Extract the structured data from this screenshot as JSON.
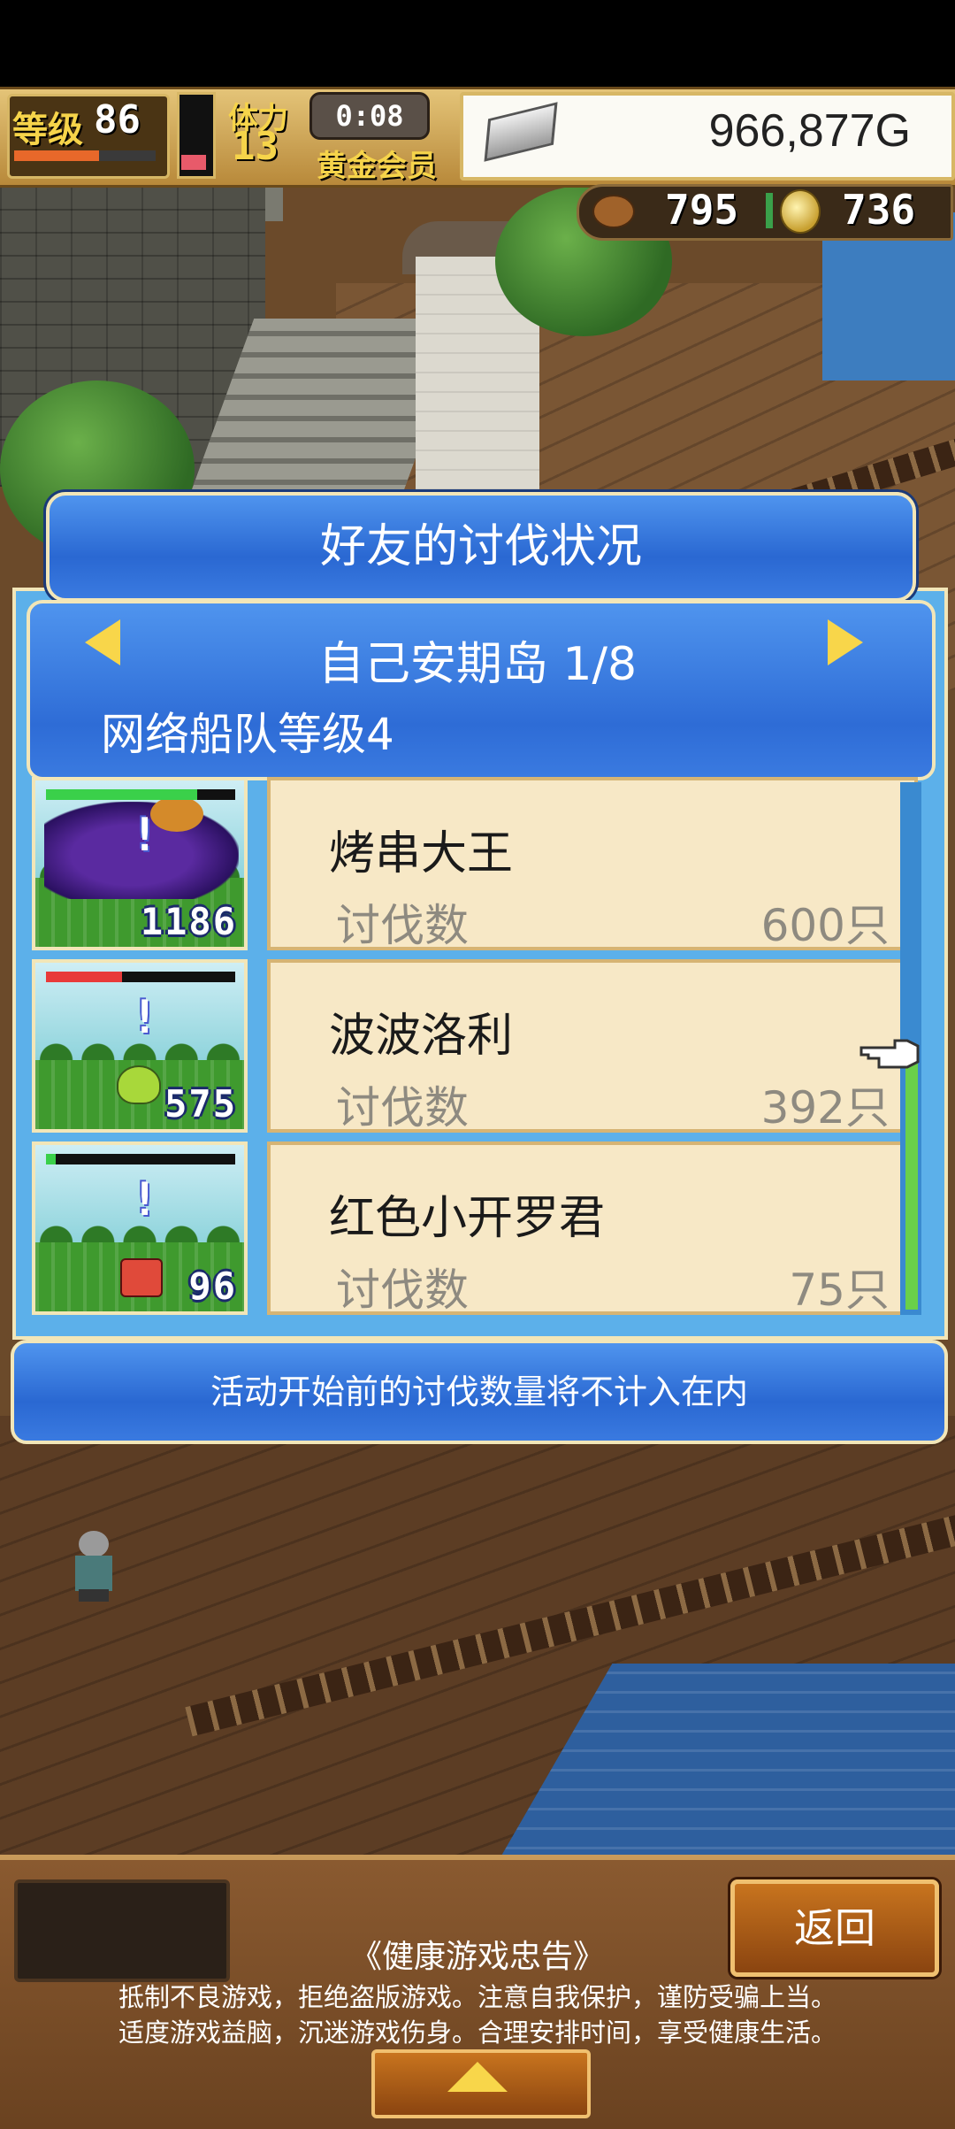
{
  "hud": {
    "level_label": "等级",
    "level": "86",
    "level_progress": 0.6,
    "stamina_level": 0.2,
    "stamina_label": "体力",
    "stamina_value": "13",
    "timer": "0:08",
    "membership": "黄金会员",
    "money": "966,877G",
    "resource_meat": "795",
    "resource_coin": "736"
  },
  "dialog": {
    "title": "好友的讨伐状况",
    "island": "自己安期岛 1/8",
    "fleet_level": "网络船队等级4",
    "friends": [
      {
        "name": "烤串大王",
        "kills_label": "讨伐数",
        "kills": "600只",
        "thumb_number": "1186",
        "hp": 0.8,
        "hp_color": "#3ad04a",
        "monster": "boss"
      },
      {
        "name": "波波洛利",
        "kills_label": "讨伐数",
        "kills": "392只",
        "thumb_number": "575",
        "hp": 0.4,
        "hp_color": "#e83a3a",
        "monster": "slime"
      },
      {
        "name": "红色小开罗君",
        "kills_label": "讨伐数",
        "kills": "75只",
        "thumb_number": "96",
        "hp": 0.05,
        "hp_color": "#3ad04a",
        "monster": "red"
      }
    ],
    "notice": "活动开始前的讨伐数量将不计入在内"
  },
  "bottom": {
    "back_label": "返回",
    "health_title": "《健康游戏忠告》",
    "health_line1": "抵制不良游戏，拒绝盗版游戏。注意自我保护，谨防受骗上当。",
    "health_line2": "适度游戏益脑，沉迷游戏伤身。合理安排时间，享受健康生活。"
  }
}
